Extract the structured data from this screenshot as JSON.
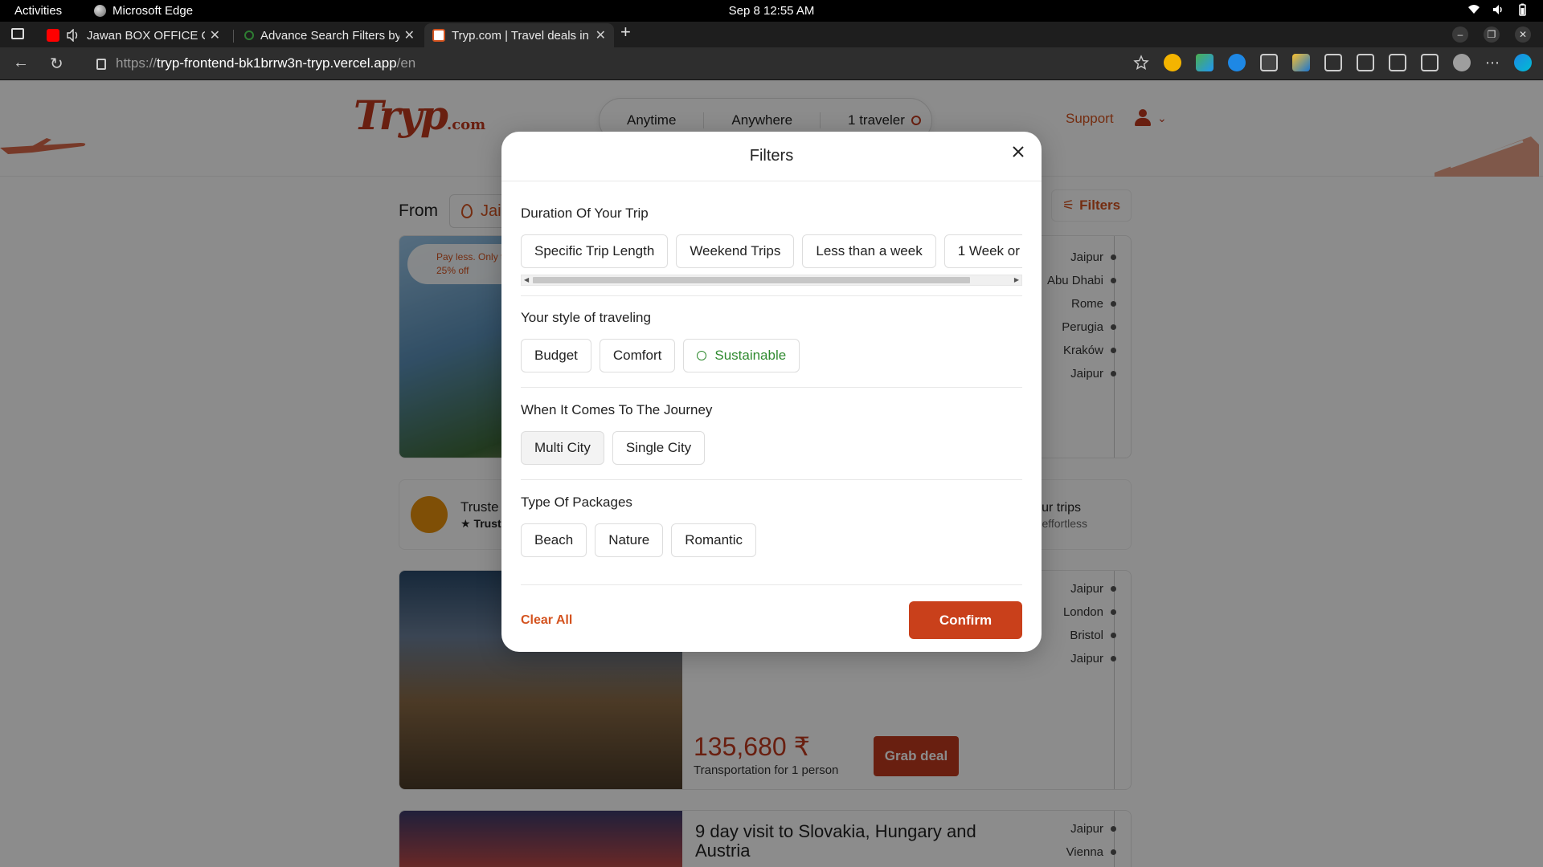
{
  "os_bar": {
    "activities": "Activities",
    "app_name": "Microsoft Edge",
    "clock": "Sep 8  12:55 AM"
  },
  "browser": {
    "tabs": [
      {
        "title": "Jawan BOX OFFICE C",
        "favicon_color": "#ff0000"
      },
      {
        "title": "Advance Search Filters by",
        "favicon_color": "#2e7d32"
      },
      {
        "title": "Tryp.com | Travel deals in",
        "favicon_color": "#d4531f"
      }
    ],
    "url_prefix": "https://",
    "url_host": "tryp-frontend-bk1brrw3n-tryp.vercel.app",
    "url_path": "/en"
  },
  "site": {
    "logo_main": "Tryp",
    "logo_suffix": ".com",
    "search": {
      "when": "Anytime",
      "where": "Anywhere",
      "who": "1 traveler"
    },
    "support": "Support",
    "from_label": "From",
    "from_value": "Jai",
    "filters_label": "Filters",
    "cards": [
      {
        "promo_line1": "Pay less. Only t",
        "promo_line2": "25% off",
        "route": [
          "Jaipur",
          "Abu Dhabi",
          "Rome",
          "Perugia",
          "Kraków",
          "Jaipur"
        ]
      },
      {
        "route": [
          "Jaipur",
          "London",
          "Bristol",
          "Jaipur"
        ],
        "price": "135,680 ₹",
        "price_note": "Transportation for 1 person",
        "cta": "Grab deal"
      },
      {
        "title": "9 day visit to Slovakia, Hungary and Austria",
        "route": [
          "Jaipur",
          "Vienna"
        ]
      }
    ],
    "trust": {
      "title": "Truste",
      "subtitle": "Trust",
      "trips_title": "ur trips",
      "trips_sub": "effortless"
    }
  },
  "modal": {
    "title": "Filters",
    "sections": {
      "duration": {
        "title": "Duration Of Your Trip",
        "options": [
          "Specific Trip Length",
          "Weekend Trips",
          "Less than a week",
          "1 Week or m"
        ]
      },
      "style": {
        "title": "Your style of traveling",
        "options": [
          "Budget",
          "Comfort",
          "Sustainable"
        ]
      },
      "journey": {
        "title": "When It Comes To The Journey",
        "options": [
          "Multi City",
          "Single City"
        ],
        "selected": "Multi City"
      },
      "packages": {
        "title": "Type Of Packages",
        "options": [
          "Beach",
          "Nature",
          "Romantic"
        ]
      }
    },
    "clear_all": "Clear All",
    "confirm": "Confirm"
  },
  "colors": {
    "brand": "#c0391e",
    "accent": "#d4531f",
    "eco": "#2f8a2f"
  }
}
